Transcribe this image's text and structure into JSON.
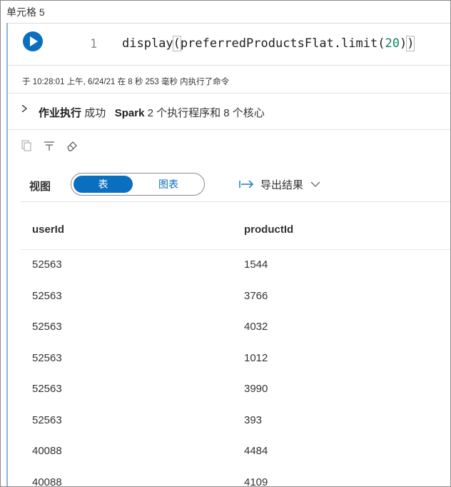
{
  "cell": {
    "title": "单元格 5",
    "line_number": "1",
    "code": {
      "before": "display",
      "open_paren": "(",
      "middle": "preferredProductsFlat.limit(",
      "number": "20",
      "close_inner": ")",
      "close_paren": ")"
    },
    "exec_info": "于 10:28:01 上午, 6/24/21 在 8 秒 253 毫秒 内执行了命令"
  },
  "job": {
    "label": "作业执行",
    "status": "成功",
    "engine": "Spark",
    "details": "2 个执行程序和 8 个核心"
  },
  "toolbar": {
    "icons": [
      "copy-icon",
      "filter-icon",
      "eraser-icon"
    ]
  },
  "view": {
    "label": "视图",
    "table_tab": "表",
    "chart_tab": "图表",
    "export_label": "导出结果"
  },
  "table": {
    "columns": [
      "userId",
      "productId"
    ],
    "rows": [
      [
        "52563",
        "1544"
      ],
      [
        "52563",
        "3766"
      ],
      [
        "52563",
        "4032"
      ],
      [
        "52563",
        "1012"
      ],
      [
        "52563",
        "3990"
      ],
      [
        "52563",
        "393"
      ],
      [
        "40088",
        "4484"
      ],
      [
        "40088",
        "4109"
      ]
    ]
  },
  "colors": {
    "accent": "#0b6fbf",
    "number": "#098658",
    "cell_border": "#8cb4e0"
  }
}
